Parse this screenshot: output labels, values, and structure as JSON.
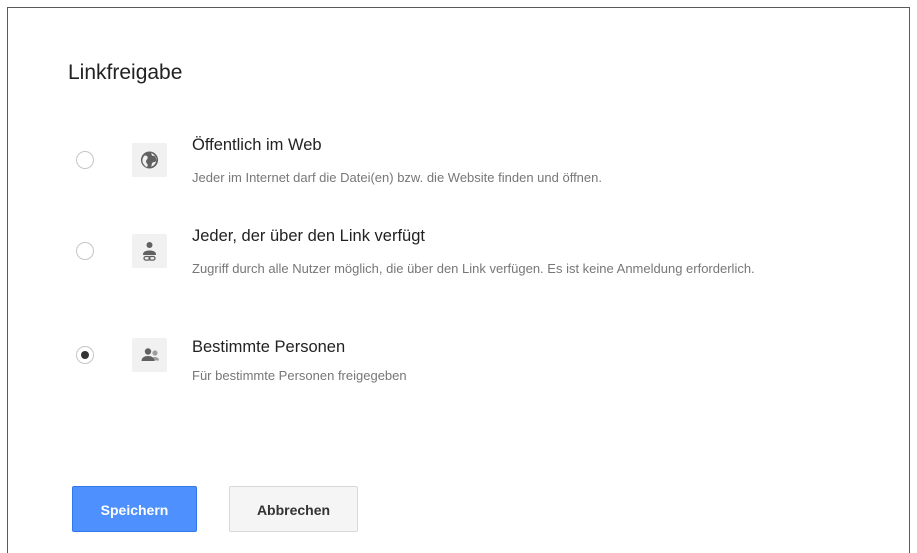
{
  "dialog": {
    "title": "Linkfreigabe",
    "options": [
      {
        "label": "Öffentlich im Web",
        "description": "Jeder im Internet darf die Datei(en) bzw. die Website finden und öffnen.",
        "icon": "globe-icon",
        "selected": false
      },
      {
        "label": "Jeder, der über den Link verfügt",
        "description": "Zugriff durch alle Nutzer möglich, die über den Link verfügen. Es ist keine Anmeldung erforderlich.",
        "icon": "person-link-icon",
        "selected": false
      },
      {
        "label": "Bestimmte Personen",
        "description": "Für bestimmte Personen freigegeben",
        "icon": "people-icon",
        "selected": true
      }
    ],
    "buttons": {
      "save_label": "Speichern",
      "cancel_label": "Abbrechen"
    },
    "colors": {
      "primary": "#4d90fe",
      "text": "#222222",
      "muted": "#777777"
    }
  }
}
